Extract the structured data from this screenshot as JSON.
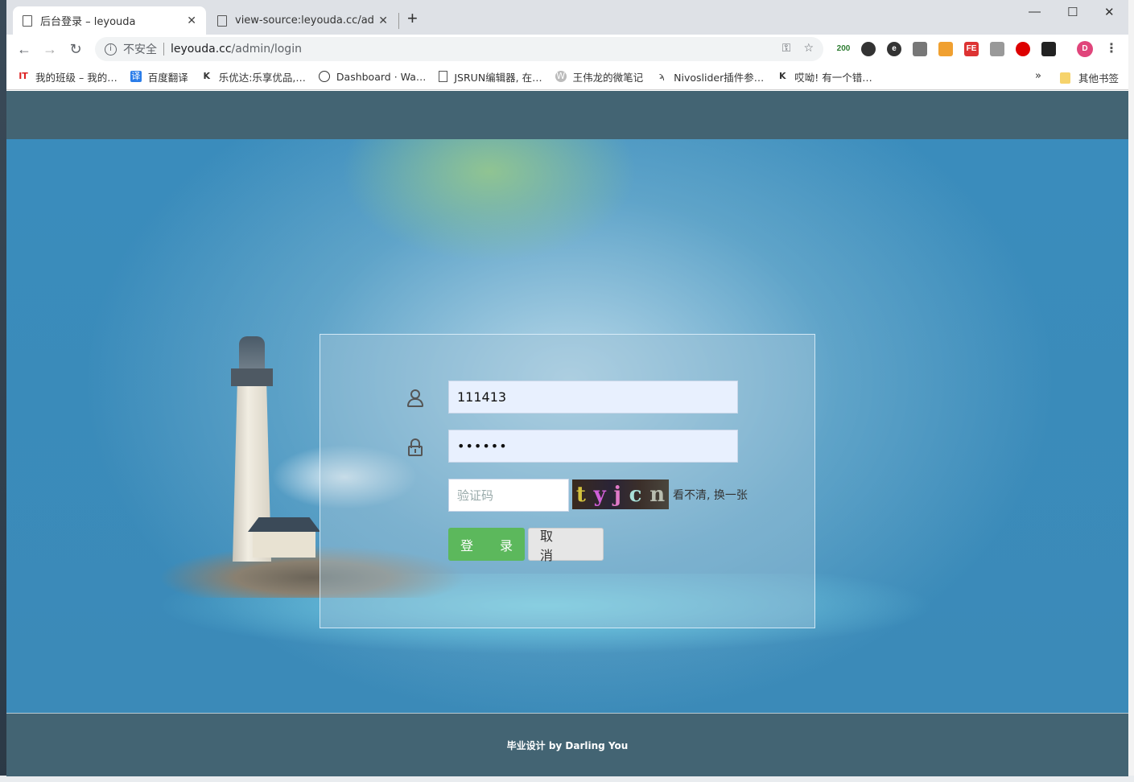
{
  "browser": {
    "tabs": [
      {
        "label": "后台登录 – leyouda",
        "active": true
      },
      {
        "label": "view-source:leyouda.cc/admin/",
        "active": false
      }
    ],
    "new_tab_label": "+",
    "window_controls": {
      "minimize": "—",
      "maximize": "☐",
      "close": "✕"
    },
    "address": {
      "security_label": "不安全",
      "host": "leyouda.cc",
      "path": "/admin/login"
    },
    "extension_badge": "200",
    "profile_initial": "D",
    "bookmarks": [
      {
        "label": "我的班级 – 我的…",
        "icon": "bookmark-favicon"
      },
      {
        "label": "百度翻译",
        "icon": "translate-icon"
      },
      {
        "label": "乐优达:乐享优品,…",
        "icon": "k-logo-icon"
      },
      {
        "label": "Dashboard · Wa…",
        "icon": "clock-icon"
      },
      {
        "label": "JSRUN编辑器, 在…",
        "icon": "page-icon"
      },
      {
        "label": "王伟龙的微笔记",
        "icon": "w-circle-icon"
      },
      {
        "label": "Nivoslider插件参…",
        "icon": "feather-icon"
      },
      {
        "label": "哎呦! 有一个错…",
        "icon": "k-logo-icon"
      }
    ],
    "bookmarks_more": "»",
    "other_bookmarks": "其他书签"
  },
  "login": {
    "username_value": "111413",
    "password_value": "••••••",
    "captcha_placeholder": "验证码",
    "captcha_chars": [
      "t",
      "y",
      "j",
      "c",
      "n"
    ],
    "refresh_captcha_label": "看不清, 换一张",
    "login_button": "登 录",
    "cancel_button": "取 消"
  },
  "footer": {
    "text": "毕业设计 by Darling You"
  },
  "colors": {
    "header_band": "#436473",
    "login_button": "#5cb85c",
    "sky": "#3a8cbc"
  }
}
